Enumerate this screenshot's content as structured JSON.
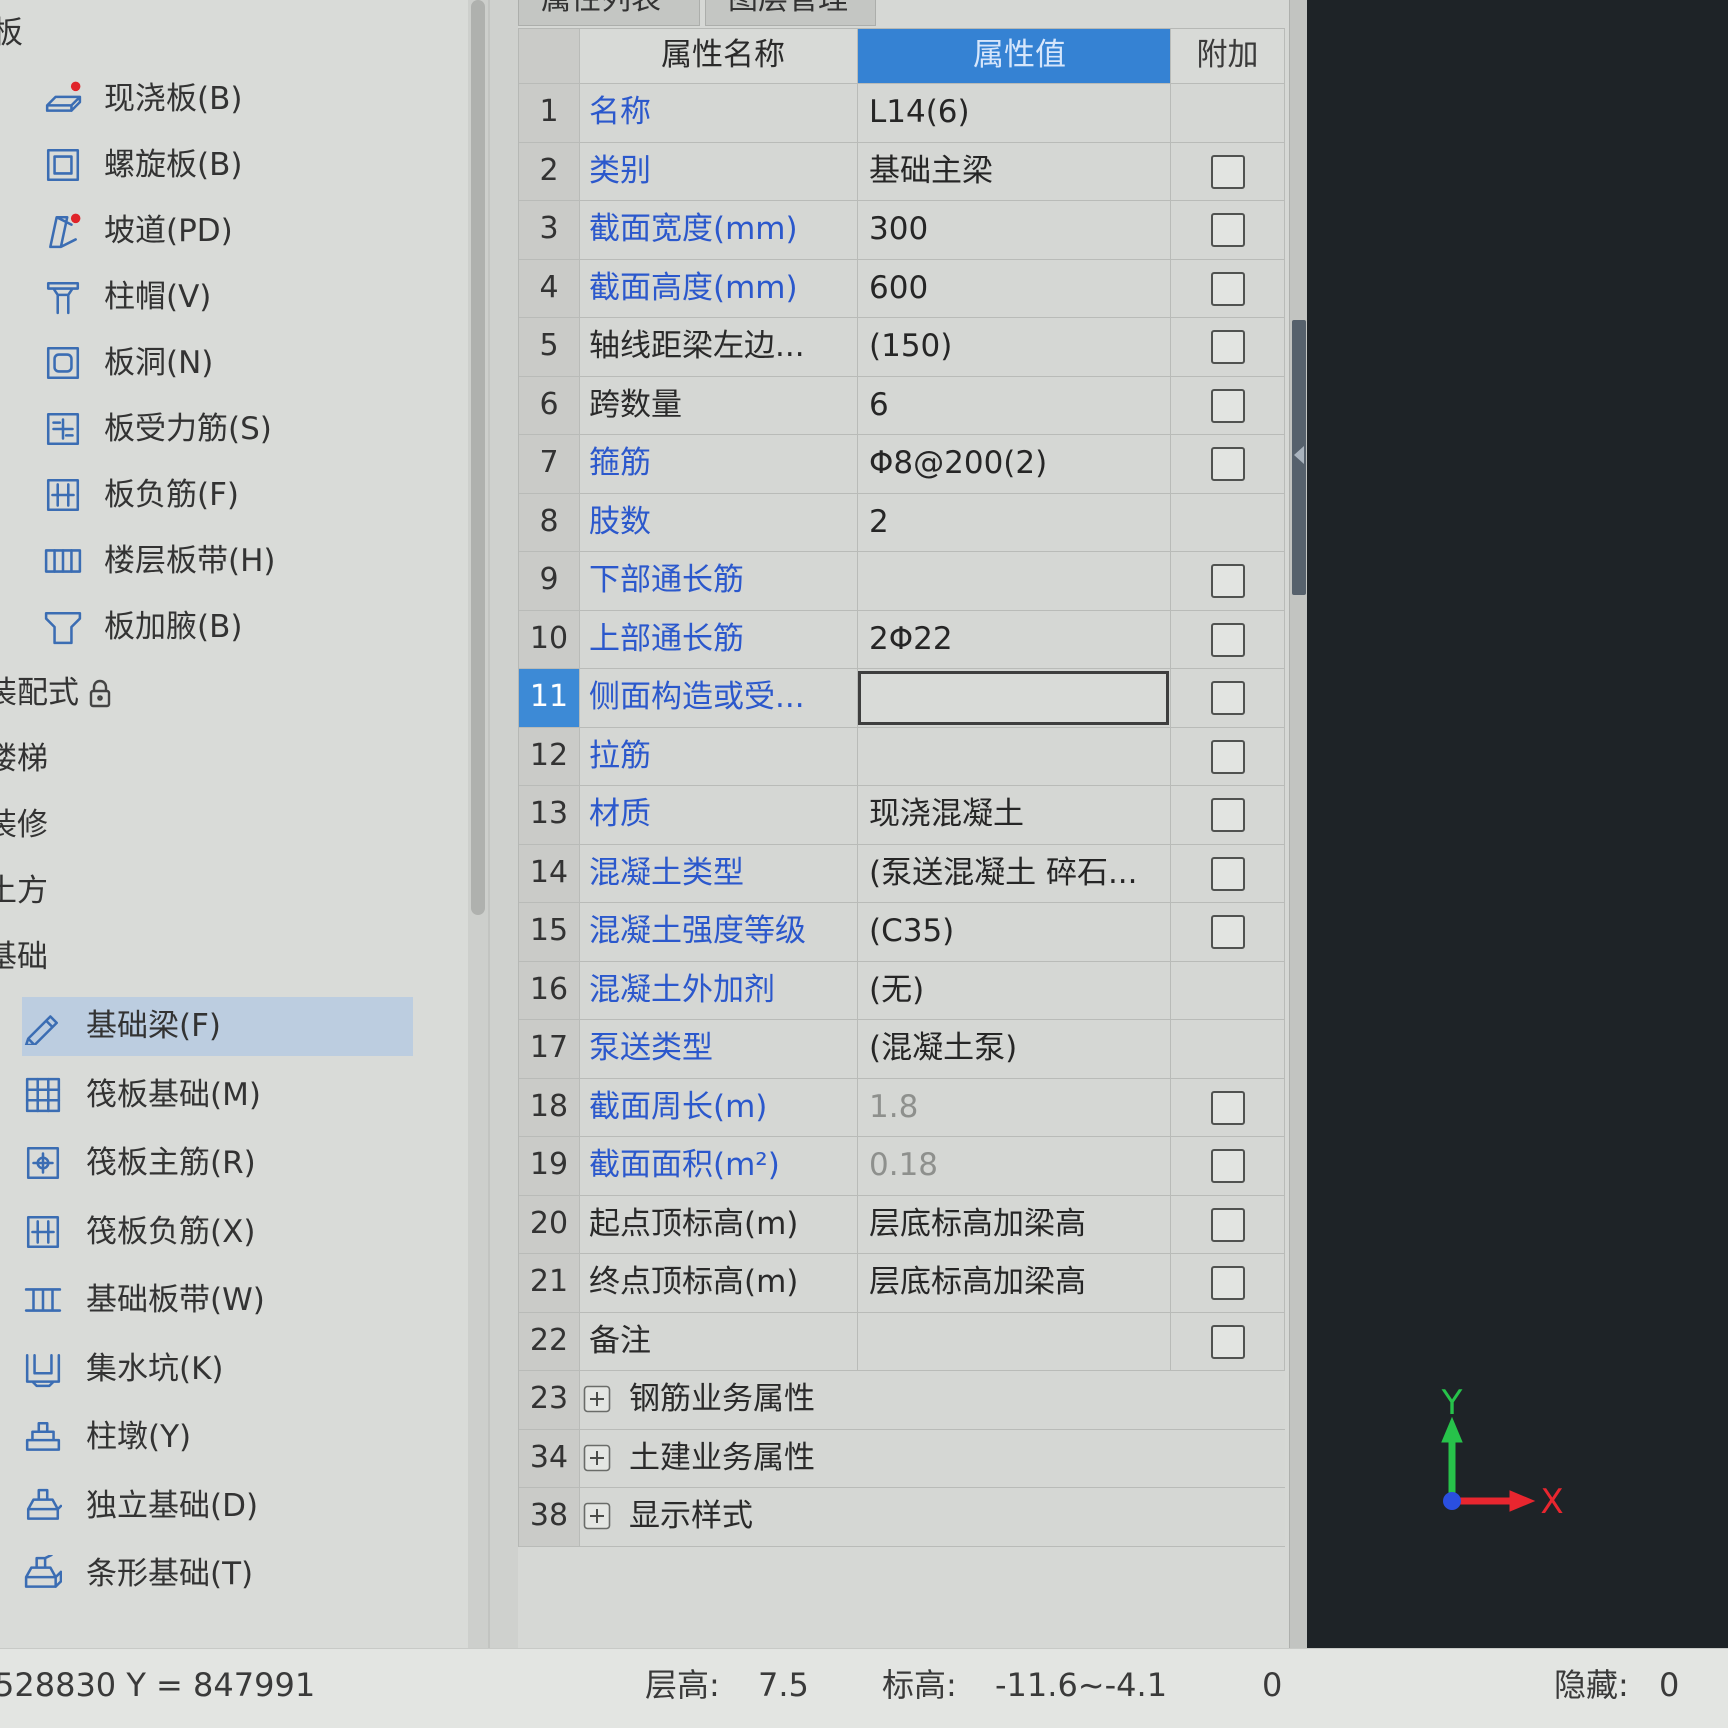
{
  "app": {
    "tabs": [
      "属性列表",
      "图层管理"
    ]
  },
  "tree": {
    "top_items": [
      {
        "label": "板",
        "is_group": true
      },
      {
        "label": "现浇板(B)",
        "icon": "cast-slab-icon"
      },
      {
        "label": "螺旋板(B)",
        "icon": "spiral-slab-icon"
      },
      {
        "label": "坡道(PD)",
        "icon": "ramp-icon"
      },
      {
        "label": "柱帽(V)",
        "icon": "column-cap-icon"
      },
      {
        "label": "板洞(N)",
        "icon": "slab-hole-icon"
      },
      {
        "label": "板受力筋(S)",
        "icon": "slab-rebar-icon"
      },
      {
        "label": "板负筋(F)",
        "icon": "slab-negative-rebar-icon"
      },
      {
        "label": "楼层板带(H)",
        "icon": "floor-strip-icon"
      },
      {
        "label": "板加腋(B)",
        "icon": "slab-haunch-icon"
      },
      {
        "label": "装配式",
        "is_group": true,
        "icon": "lock-icon"
      },
      {
        "label": "楼梯",
        "is_group": true
      },
      {
        "label": "装修",
        "is_group": true
      },
      {
        "label": "土方",
        "is_group": true
      },
      {
        "label": "基础",
        "is_group": true
      }
    ],
    "foundation_items": [
      {
        "label": "基础梁(F)",
        "icon": "foundation-beam-icon",
        "selected": true
      },
      {
        "label": "筏板基础(M)",
        "icon": "raft-foundation-icon"
      },
      {
        "label": "筏板主筋(R)",
        "icon": "raft-main-rebar-icon"
      },
      {
        "label": "筏板负筋(X)",
        "icon": "raft-negative-rebar-icon"
      },
      {
        "label": "基础板带(W)",
        "icon": "foundation-strip-icon"
      },
      {
        "label": "集水坑(K)",
        "icon": "sump-icon"
      },
      {
        "label": "柱墩(Y)",
        "icon": "column-pier-icon"
      },
      {
        "label": "独立基础(D)",
        "icon": "isolated-footing-icon"
      },
      {
        "label": "条形基础(T)",
        "icon": "strip-footing-icon"
      }
    ]
  },
  "properties": {
    "columns": {
      "name": "属性名称",
      "value": "属性值",
      "extra": "附加"
    },
    "rows": [
      {
        "num": "1",
        "name": "名称",
        "value": "L14(6)",
        "name_link": true,
        "checkbox": false
      },
      {
        "num": "2",
        "name": "类别",
        "value": "基础主梁",
        "name_link": true,
        "checkbox": true
      },
      {
        "num": "3",
        "name": "截面宽度(mm)",
        "value": "300",
        "name_link": true,
        "checkbox": true
      },
      {
        "num": "4",
        "name": "截面高度(mm)",
        "value": "600",
        "name_link": true,
        "checkbox": true
      },
      {
        "num": "5",
        "name": "轴线距梁左边...",
        "value": "(150)",
        "name_link": false,
        "checkbox": true
      },
      {
        "num": "6",
        "name": "跨数量",
        "value": "6",
        "name_link": false,
        "checkbox": true
      },
      {
        "num": "7",
        "name": "箍筋",
        "value": "Φ8@200(2)",
        "name_link": true,
        "checkbox": true
      },
      {
        "num": "8",
        "name": "肢数",
        "value": "2",
        "name_link": true,
        "checkbox": false
      },
      {
        "num": "9",
        "name": "下部通长筋",
        "value": "",
        "name_link": true,
        "checkbox": true
      },
      {
        "num": "10",
        "name": "上部通长筋",
        "value": "2Φ22",
        "name_link": true,
        "checkbox": true
      },
      {
        "num": "11",
        "name": "侧面构造或受...",
        "value": "",
        "name_link": true,
        "checkbox": true,
        "selected": true
      },
      {
        "num": "12",
        "name": "拉筋",
        "value": "",
        "name_link": true,
        "checkbox": true
      },
      {
        "num": "13",
        "name": "材质",
        "value": "现浇混凝土",
        "name_link": true,
        "checkbox": true
      },
      {
        "num": "14",
        "name": "混凝土类型",
        "value": "(泵送混凝土 碎石...",
        "name_link": true,
        "checkbox": true
      },
      {
        "num": "15",
        "name": "混凝土强度等级",
        "value": "(C35)",
        "name_link": true,
        "checkbox": true
      },
      {
        "num": "16",
        "name": "混凝土外加剂",
        "value": "(无)",
        "name_link": true,
        "checkbox": false
      },
      {
        "num": "17",
        "name": "泵送类型",
        "value": "(混凝土泵)",
        "name_link": true,
        "checkbox": false
      },
      {
        "num": "18",
        "name": "截面周长(m)",
        "value": "1.8",
        "name_link": true,
        "checkbox": true,
        "value_dim": true
      },
      {
        "num": "19",
        "name": "截面面积(m²)",
        "value": "0.18",
        "name_link": true,
        "checkbox": true,
        "value_dim": true
      },
      {
        "num": "20",
        "name": "起点顶标高(m)",
        "value": "层底标高加梁高",
        "name_link": false,
        "checkbox": true
      },
      {
        "num": "21",
        "name": "终点顶标高(m)",
        "value": "层底标高加梁高",
        "name_link": false,
        "checkbox": true
      },
      {
        "num": "22",
        "name": "备注",
        "value": "",
        "name_link": false,
        "checkbox": true
      },
      {
        "num": "23",
        "name": "钢筋业务属性",
        "group": true
      },
      {
        "num": "34",
        "name": "土建业务属性",
        "group": true
      },
      {
        "num": "38",
        "name": "显示样式",
        "group": true
      }
    ]
  },
  "viewport": {
    "axis_x_label": "X",
    "axis_y_label": "Y"
  },
  "status": {
    "coords": "528830 Y = 847991",
    "floor_height_label": "层高:",
    "floor_height": "7.5",
    "elevation_label": "标高:",
    "elevation": "-11.6~-4.1",
    "count": "0",
    "hidden_label": "隐藏:",
    "hidden": "0"
  },
  "colors": {
    "accent": "#3582d3",
    "link_text": "#2b58cc",
    "selected_row": "#3d8ad6",
    "dim_text": "#8e908d",
    "viewport_bg": "#1e2327",
    "axis_x": "#e8262f",
    "axis_y": "#27c24a",
    "axis_origin": "#2a4fe0"
  }
}
